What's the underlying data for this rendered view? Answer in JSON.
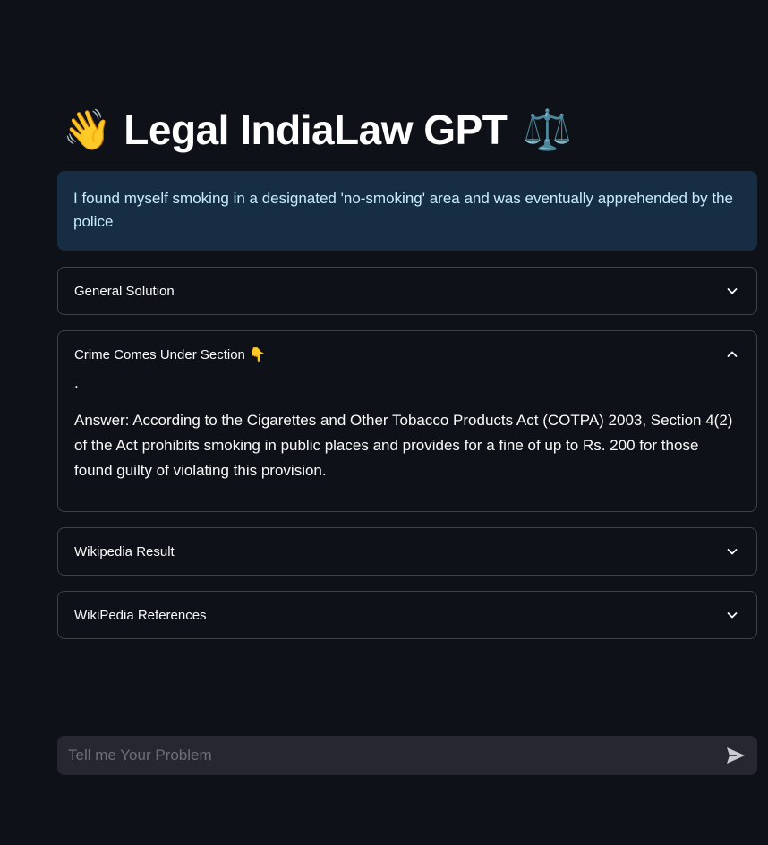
{
  "title": {
    "emoji_left": "👋",
    "text": "Legal IndiaLaw GPT",
    "emoji_right": "⚖️"
  },
  "query": {
    "text": "I found myself smoking in a designated 'no-smoking' area and was eventually apprehended by the police"
  },
  "expanders": [
    {
      "label": "General Solution",
      "expanded": false
    },
    {
      "label": "Crime Comes Under Section 👇",
      "expanded": true,
      "body_dot": ".",
      "body_text": "Answer: According to the Cigarettes and Other Tobacco Products Act (COTPA) 2003, Section 4(2) of the Act prohibits smoking in public places and provides for a fine of up to Rs. 200 for those found guilty of violating this provision."
    },
    {
      "label": "Wikipedia Result",
      "expanded": false
    },
    {
      "label": "WikiPedia References",
      "expanded": false
    }
  ],
  "chat_input": {
    "placeholder": "Tell me Your Problem",
    "value": ""
  },
  "icons": {
    "chevron_down": "chevron-down-icon",
    "chevron_up": "chevron-up-icon",
    "send": "send-icon"
  },
  "colors": {
    "background": "#0e1117",
    "info_bg": "#172d43",
    "info_text": "#c7ebff",
    "border": "#3d4149",
    "input_bg": "#262730"
  }
}
